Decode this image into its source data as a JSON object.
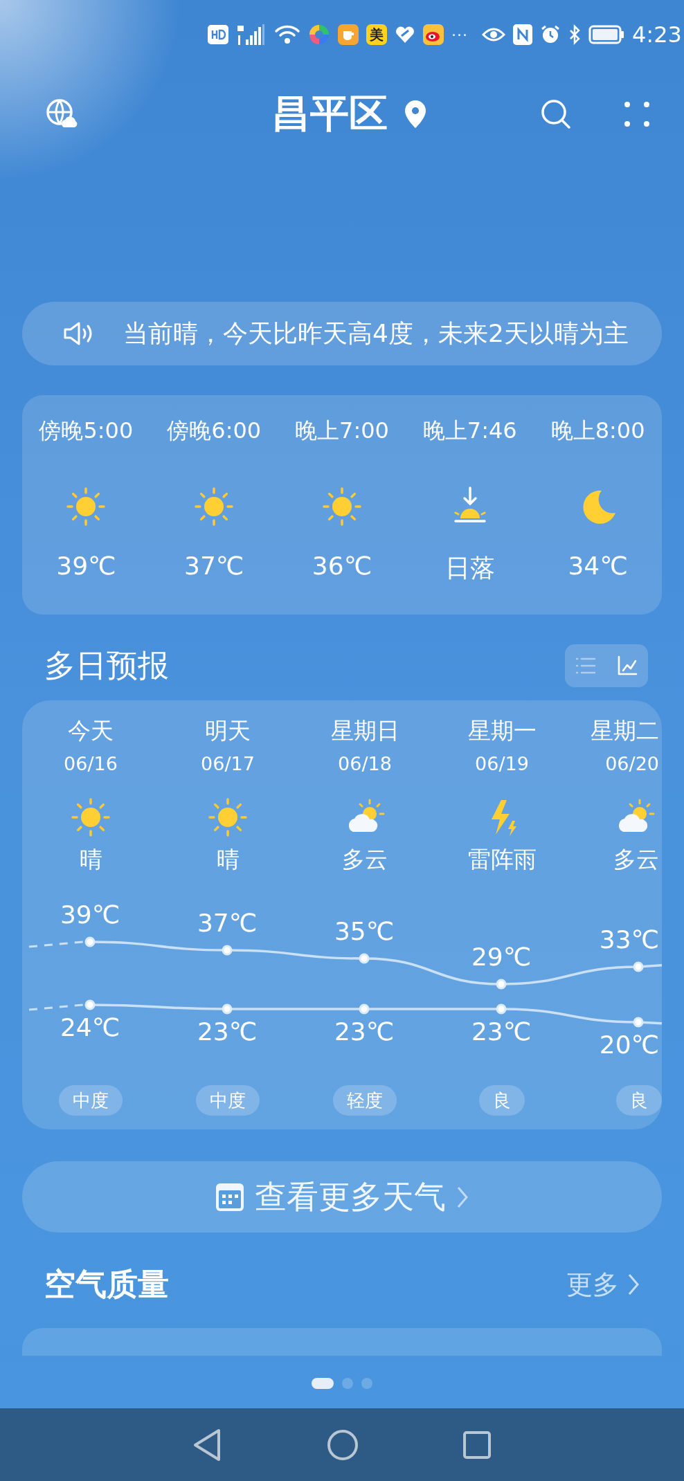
{
  "status_bar": {
    "app_badge": "美",
    "overflow": "···",
    "time": "4:23"
  },
  "header": {
    "title": "昌平区"
  },
  "notice": {
    "text": "当前晴，今天比昨天高4度，未来2天以晴为主"
  },
  "hourly": [
    {
      "time": "傍晚5:00",
      "kind": "sun",
      "temp": "39℃"
    },
    {
      "time": "傍晚6:00",
      "kind": "sun",
      "temp": "37℃"
    },
    {
      "time": "晚上7:00",
      "kind": "sun",
      "temp": "36℃"
    },
    {
      "time": "晚上7:46",
      "kind": "sunset",
      "temp": "日落"
    },
    {
      "time": "晚上8:00",
      "kind": "moon",
      "temp": "34℃"
    }
  ],
  "daily_forecast": {
    "title": "多日预报",
    "view_toggle": [
      {
        "kind": "list",
        "selected": false
      },
      {
        "kind": "chart",
        "selected": true
      }
    ],
    "days": [
      {
        "day": "今天",
        "date": "06/16",
        "kind": "sun",
        "condition": "晴",
        "high": "39℃",
        "low": "24℃",
        "air": "中度"
      },
      {
        "day": "明天",
        "date": "06/17",
        "kind": "sun",
        "condition": "晴",
        "high": "37℃",
        "low": "23℃",
        "air": "中度"
      },
      {
        "day": "星期日",
        "date": "06/18",
        "kind": "cloudsun",
        "condition": "多云",
        "high": "35℃",
        "low": "23℃",
        "air": "轻度"
      },
      {
        "day": "星期一",
        "date": "06/19",
        "kind": "thunder",
        "condition": "雷阵雨",
        "high": "29℃",
        "low": "23℃",
        "air": "良"
      },
      {
        "day": "星期二",
        "date": "06/20",
        "kind": "cloudsun",
        "condition": "多云",
        "high": "33℃",
        "low": "20℃",
        "air": "良"
      }
    ]
  },
  "more_weather_button": "查看更多天气",
  "air_quality": {
    "title": "空气质量",
    "more": "更多"
  },
  "pages": [
    {
      "selected": true
    },
    {
      "selected": false
    },
    {
      "selected": false
    }
  ]
}
